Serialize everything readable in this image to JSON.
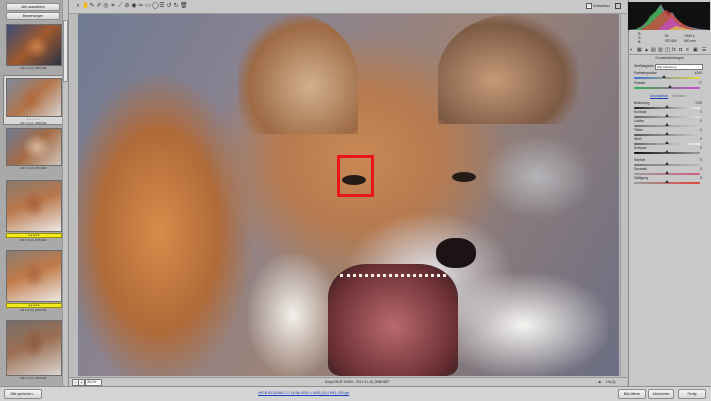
{
  "filmstrip": {
    "select_all_label": "Alle auswählen",
    "rate_label": "Bewertungen",
    "thumbnails": [
      {
        "name": "2017-01-16_0085.NEF",
        "stars": "",
        "label": ""
      },
      {
        "name": "2017-01-16_0088.NEF",
        "stars": "• • • • •",
        "label": ""
      },
      {
        "name": "2017-01-16_0091.NEF",
        "stars": "",
        "label": ""
      },
      {
        "name": "2017-01-16_0095.NEF",
        "stars": "",
        "label": "★★★★★"
      },
      {
        "name": "2017-01-16_0099.NEF",
        "stars": "",
        "label": "★★★★★"
      },
      {
        "name": "2017-01-16_0103.NEF",
        "stars": "",
        "label": ""
      }
    ]
  },
  "toolbar": {
    "tools": [
      "zoom-icon",
      "hand-icon",
      "eyedropper-icon",
      "color-sampler-icon",
      "target-adjust-icon",
      "crop-icon",
      "straighten-icon",
      "spot-removal-icon",
      "red-eye-icon",
      "brush-icon",
      "graduated-filter-icon",
      "radial-filter-icon",
      "preferences-icon",
      "rotate-left-icon",
      "rotate-right-icon",
      "trash-icon"
    ],
    "preview_label": "Vorschau"
  },
  "statusbar": {
    "zoom_value": "35,0%",
    "filename": "Sony DSLR-TX400 - 2017-01-16_0088.NEF",
    "image_counter": "1/6 (3)"
  },
  "histogram_info": {
    "r": "R:",
    "g": "G:",
    "b": "B:",
    "aperture": "f/4",
    "shutter": "1/500 s",
    "iso": "ISO 800",
    "focal": "600 mm"
  },
  "panel": {
    "title": "Grundeinstellungen",
    "wb_label": "Weißabgleich:",
    "wb_value": "Wie Aufnahme",
    "temp_label": "Farbtemperatur",
    "temp_value": "4200",
    "tint_label": "Farbton",
    "tint_value": "+7",
    "auto_label": "Automatisch",
    "default_label": "Standard",
    "sliders": [
      {
        "label": "Belichtung",
        "value": "0,00"
      },
      {
        "label": "Kontrast",
        "value": "0"
      },
      {
        "label": "Lichter",
        "value": "0"
      },
      {
        "label": "Tiefen",
        "value": "0"
      },
      {
        "label": "Weiß",
        "value": "0"
      },
      {
        "label": "Schwarz",
        "value": "0"
      },
      {
        "label": "Klarheit",
        "value": "0"
      },
      {
        "label": "Dynamik",
        "value": "0"
      },
      {
        "label": "Sättigung",
        "value": "0"
      }
    ]
  },
  "bottombar": {
    "save_label": "Bild speichern...",
    "workflow_link": "sRGB IEC61966-2.1; 16 Bit; 6000 × 4000 (24,0 MP); 300 ppi",
    "open_label": "Bild öffnen",
    "cancel_label": "Abbrechen",
    "done_label": "Fertig"
  }
}
